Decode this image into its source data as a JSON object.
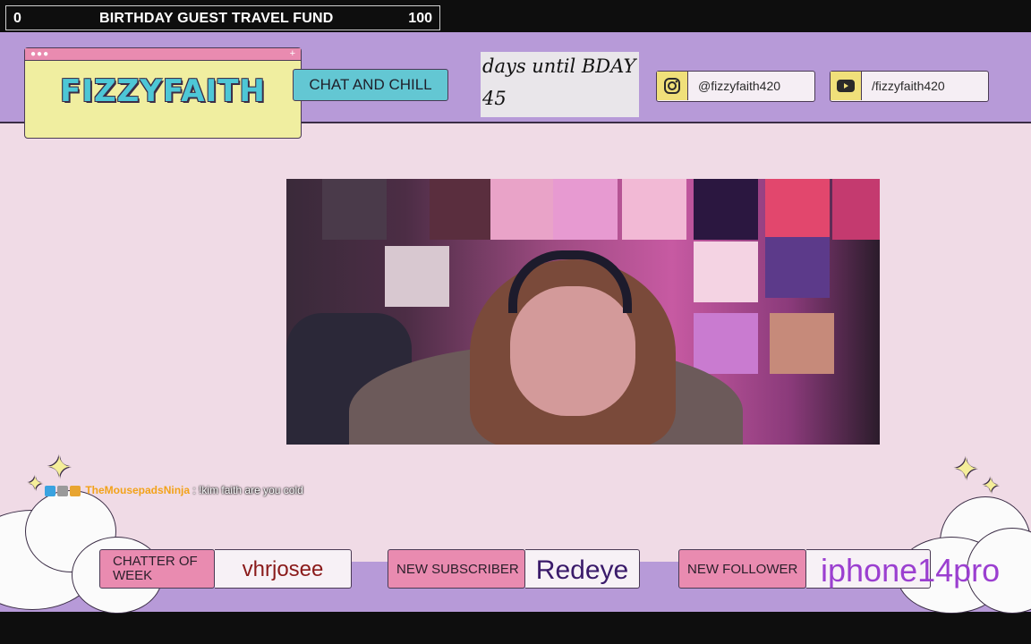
{
  "goal": {
    "current": "0",
    "title": "BIRTHDAY GUEST TRAVEL FUND",
    "target": "100"
  },
  "logo": {
    "text": "FIZZYFAITH",
    "window_dots": "●●●",
    "window_plus": "+"
  },
  "tag": {
    "label": "CHAT AND CHILL"
  },
  "countdown": {
    "line1": "days until BDAY",
    "days": "45"
  },
  "socials": [
    {
      "icon": "instagram-icon",
      "handle": "@fizzyfaith420"
    },
    {
      "icon": "youtube-icon",
      "handle": "/fizzyfaith420"
    }
  ],
  "chat": {
    "username": "TheMousepadsNinja",
    "separator": ":",
    "message": "!kim faith are you cold"
  },
  "bottom": {
    "chatter": {
      "label": "CHATTER OF WEEK",
      "value": "vhrjosee"
    },
    "subscriber": {
      "label": "NEW SUBSCRIBER",
      "value": "Redeye"
    },
    "follower": {
      "label": "NEW FOLLOWER",
      "value": "iphone14pro"
    }
  },
  "colors": {
    "pink_bg": "#f0dbe6",
    "purple_band": "#b79ad8",
    "label_pink": "#e98bb0",
    "teal": "#63c7d3",
    "yellow": "#f0eea0",
    "chatter_value": "#8a1a1a",
    "subscriber_value": "#3a1a6a",
    "follower_value": "#9b3fd0",
    "chat_username": "#f2a21a"
  }
}
